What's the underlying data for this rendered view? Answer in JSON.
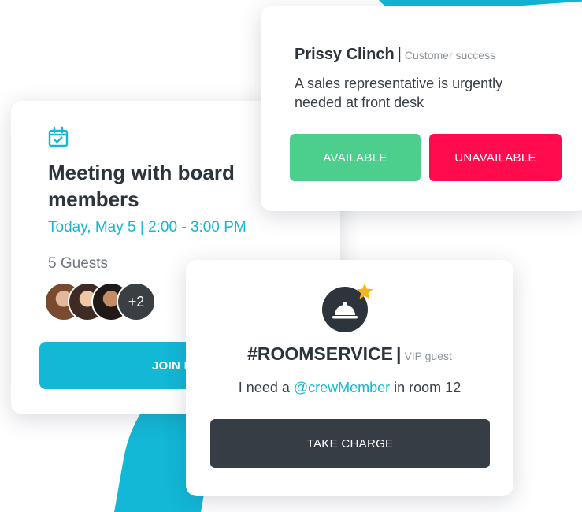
{
  "colors": {
    "accent": "#12b8d6",
    "available": "#4ccf8c",
    "unavailable": "#ff0b4e",
    "dark": "#363d45"
  },
  "meeting": {
    "icon": "calendar-check-icon",
    "title": "Meeting with board members",
    "time": "Today, May 5 | 2:00 - 3:00 PM",
    "guests_label": "5 Guests",
    "more_guests": "+2",
    "join_label": "JOIN MEE"
  },
  "support": {
    "name": "Prissy Clinch",
    "separator": "|",
    "role": "Customer success",
    "message": "A sales representative is urgently needed at front desk",
    "available_label": "AVAILABLE",
    "unavailable_label": "UNAVAILABLE"
  },
  "room": {
    "icon": "room-service-bell-icon",
    "badge_icon": "star-icon",
    "channel": "#ROOMSERVICE",
    "separator": "|",
    "role": "VIP guest",
    "message_before": "I need a ",
    "mention": "@crewMember",
    "message_after": " in room 12",
    "take_charge_label": "TAKE CHARGE"
  }
}
